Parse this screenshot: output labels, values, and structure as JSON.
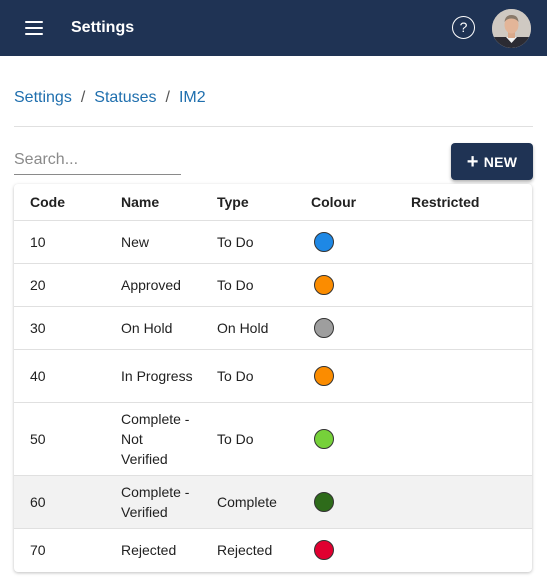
{
  "header": {
    "title": "Settings",
    "help_label": "?"
  },
  "breadcrumb": [
    "Settings",
    "Statuses",
    "IM2"
  ],
  "search": {
    "placeholder": "Search...",
    "value": ""
  },
  "new_button": {
    "label": "NEW"
  },
  "table": {
    "columns": [
      "Code",
      "Name",
      "Type",
      "Colour",
      "Restricted"
    ],
    "rows": [
      {
        "code": "10",
        "name": "New",
        "type": "To Do",
        "colour": "#1e88e5",
        "restricted": ""
      },
      {
        "code": "20",
        "name": "Approved",
        "type": "To Do",
        "colour": "#fb8c00",
        "restricted": ""
      },
      {
        "code": "30",
        "name": "On Hold",
        "type": "On Hold",
        "colour": "#9e9e9e",
        "restricted": ""
      },
      {
        "code": "40",
        "name": "In Progress",
        "type": "To Do",
        "colour": "#fb8c00",
        "restricted": ""
      },
      {
        "code": "50",
        "name": "Complete - Not Verified",
        "type": "To Do",
        "colour": "#76d13a",
        "restricted": ""
      },
      {
        "code": "60",
        "name": "Complete - Verified",
        "type": "Complete",
        "colour": "#2e6b1a",
        "restricted": ""
      },
      {
        "code": "70",
        "name": "Rejected",
        "type": "Rejected",
        "colour": "#e00030",
        "restricted": ""
      }
    ]
  },
  "theme": {
    "brand": "#1f3354",
    "link": "#1f6fae"
  },
  "icons": {
    "menu": "menu-icon",
    "help": "help-icon",
    "add": "plus-icon"
  }
}
